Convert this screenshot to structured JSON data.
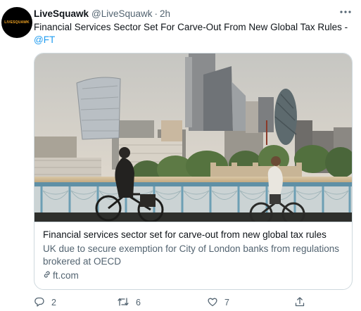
{
  "tweet": {
    "author_name": "LiveSquawk",
    "avatar_text": "LiveSquawk",
    "handle": "@LiveSquawk",
    "separator": "·",
    "time": "2h",
    "text": "Financial Services Sector Set For Carve-Out From New Global Tax Rules - ",
    "mention": "@FT"
  },
  "card": {
    "title": "Financial services sector set for carve-out from new global tax rules",
    "description": "UK due to secure exemption for City of London banks from regulations brokered at OECD",
    "domain": "ft.com",
    "domain_icon": "link-icon"
  },
  "actions": {
    "reply_count": "2",
    "retweet_count": "6",
    "like_count": "7"
  },
  "icons": [
    "more-icon",
    "reply-icon",
    "retweet-icon",
    "like-icon",
    "share-icon",
    "link-icon"
  ],
  "colors": {
    "accent": "#1d9bf0",
    "muted": "#536471",
    "text": "#0f1419",
    "border": "#cfd9de"
  }
}
